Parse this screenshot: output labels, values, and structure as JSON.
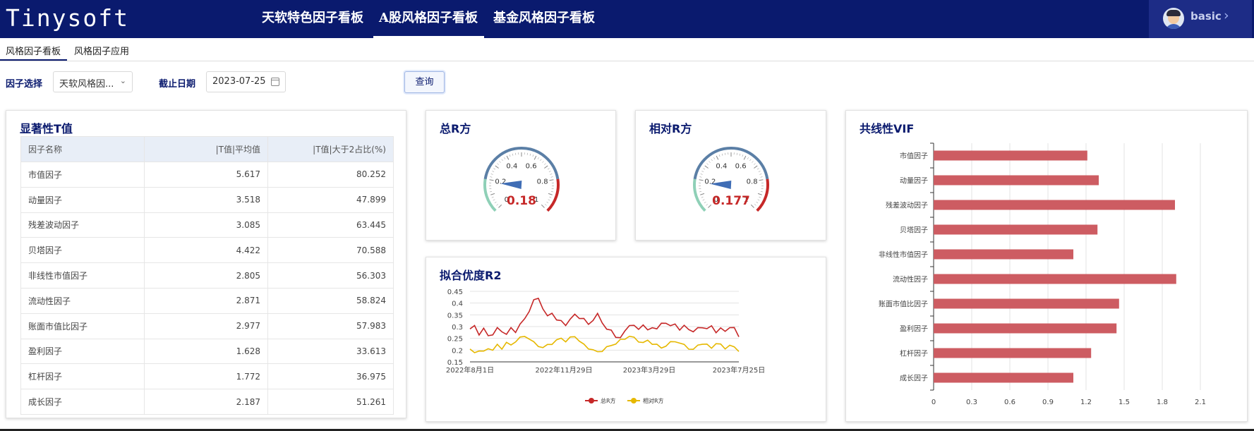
{
  "app": {
    "logo": "Tinysoft"
  },
  "nav": {
    "tabs": [
      {
        "label": "天软特色因子看板"
      },
      {
        "label": "A股风格因子看板"
      },
      {
        "label": "基金风格因子看板"
      }
    ],
    "active": 1
  },
  "user": {
    "name": "basic",
    "chevron": "›"
  },
  "subtabs": [
    {
      "label": "风格因子看板"
    },
    {
      "label": "风格因子应用"
    }
  ],
  "filters": {
    "factor_label": "因子选择",
    "factor_value": "天软风格因...",
    "date_label": "截止日期",
    "date_value": "2023-07-25",
    "query_label": "查询"
  },
  "tstat_panel": {
    "title": "显著性T值",
    "headers": [
      "因子名称",
      "|T值|平均值",
      "|T值|大于2占比(%)"
    ],
    "rows": [
      [
        "市值因子",
        "5.617",
        "80.252"
      ],
      [
        "动量因子",
        "3.518",
        "47.899"
      ],
      [
        "残差波动因子",
        "3.085",
        "63.445"
      ],
      [
        "贝塔因子",
        "4.422",
        "70.588"
      ],
      [
        "非线性市值因子",
        "2.805",
        "56.303"
      ],
      [
        "流动性因子",
        "2.871",
        "58.824"
      ],
      [
        "账面市值比因子",
        "2.977",
        "57.983"
      ],
      [
        "盈利因子",
        "1.628",
        "33.613"
      ],
      [
        "杠杆因子",
        "1.772",
        "36.975"
      ],
      [
        "成长因子",
        "2.187",
        "51.261"
      ]
    ]
  },
  "gauges": [
    {
      "title": "总R方",
      "value": 0.18,
      "display": "0.18"
    },
    {
      "title": "相对R方",
      "value": 0.177,
      "display": "0.177"
    }
  ],
  "gauge_ticks": [
    "0",
    "0.2",
    "0.4",
    "0.6",
    "0.8",
    "1"
  ],
  "colors": {
    "navy": "#0a1a6e",
    "red": "#c62828",
    "gold": "#e6b800",
    "bar": "#cd5c62",
    "needle": "#3f6db5"
  },
  "r2_panel": {
    "title": "拟合优度R2"
  },
  "vif_panel": {
    "title": "共线性VIF"
  },
  "chart_data": [
    {
      "type": "line",
      "title": "拟合优度R2",
      "x_ticks": [
        "2022年8月1日",
        "2022年11月29日",
        "2023年3月29日",
        "2023年7月25日"
      ],
      "ylim": [
        0.15,
        0.45
      ],
      "y_ticks": [
        "0.45",
        "0.4",
        "0.35",
        "0.3",
        "0.25",
        "0.2",
        "0.15"
      ],
      "legend": "bottom",
      "series": [
        {
          "name": "总R方",
          "color": "#c62828",
          "values": [
            0.29,
            0.3,
            0.27,
            0.29,
            0.26,
            0.27,
            0.29,
            0.28,
            0.27,
            0.29,
            0.28,
            0.31,
            0.33,
            0.37,
            0.41,
            0.42,
            0.38,
            0.34,
            0.36,
            0.33,
            0.32,
            0.31,
            0.33,
            0.35,
            0.34,
            0.33,
            0.31,
            0.33,
            0.35,
            0.32,
            0.29,
            0.28,
            0.26,
            0.25,
            0.28,
            0.31,
            0.3,
            0.29,
            0.31,
            0.28,
            0.3,
            0.29,
            0.31,
            0.32,
            0.3,
            0.31,
            0.29,
            0.3,
            0.29,
            0.28,
            0.29,
            0.3,
            0.29,
            0.3,
            0.28,
            0.29,
            0.28,
            0.3,
            0.29,
            0.26
          ]
        },
        {
          "name": "相对R方",
          "color": "#e6b800",
          "values": [
            0.2,
            0.19,
            0.2,
            0.19,
            0.21,
            0.2,
            0.22,
            0.21,
            0.23,
            0.22,
            0.24,
            0.25,
            0.26,
            0.25,
            0.23,
            0.22,
            0.21,
            0.22,
            0.23,
            0.24,
            0.25,
            0.24,
            0.25,
            0.26,
            0.24,
            0.22,
            0.21,
            0.2,
            0.19,
            0.2,
            0.21,
            0.22,
            0.23,
            0.24,
            0.25,
            0.26,
            0.25,
            0.24,
            0.23,
            0.24,
            0.23,
            0.22,
            0.21,
            0.22,
            0.23,
            0.24,
            0.23,
            0.22,
            0.21,
            0.2,
            0.22,
            0.23,
            0.22,
            0.21,
            0.23,
            0.22,
            0.21,
            0.22,
            0.21,
            0.2
          ]
        }
      ]
    },
    {
      "type": "bar",
      "title": "共线性VIF",
      "orientation": "horizontal",
      "categories": [
        "市值因子",
        "动量因子",
        "残差波动因子",
        "贝塔因子",
        "非线性市值因子",
        "流动性因子",
        "账面市值比因子",
        "盈利因子",
        "杠杆因子",
        "成长因子"
      ],
      "values": [
        1.21,
        1.3,
        1.9,
        1.29,
        1.1,
        1.91,
        1.46,
        1.44,
        1.24,
        1.1
      ],
      "xlim": [
        0,
        2.1
      ],
      "x_ticks": [
        "0",
        "0.3",
        "0.6",
        "0.9",
        "1.2",
        "1.5",
        "1.8",
        "2.1"
      ],
      "color": "#cd5c62"
    }
  ]
}
